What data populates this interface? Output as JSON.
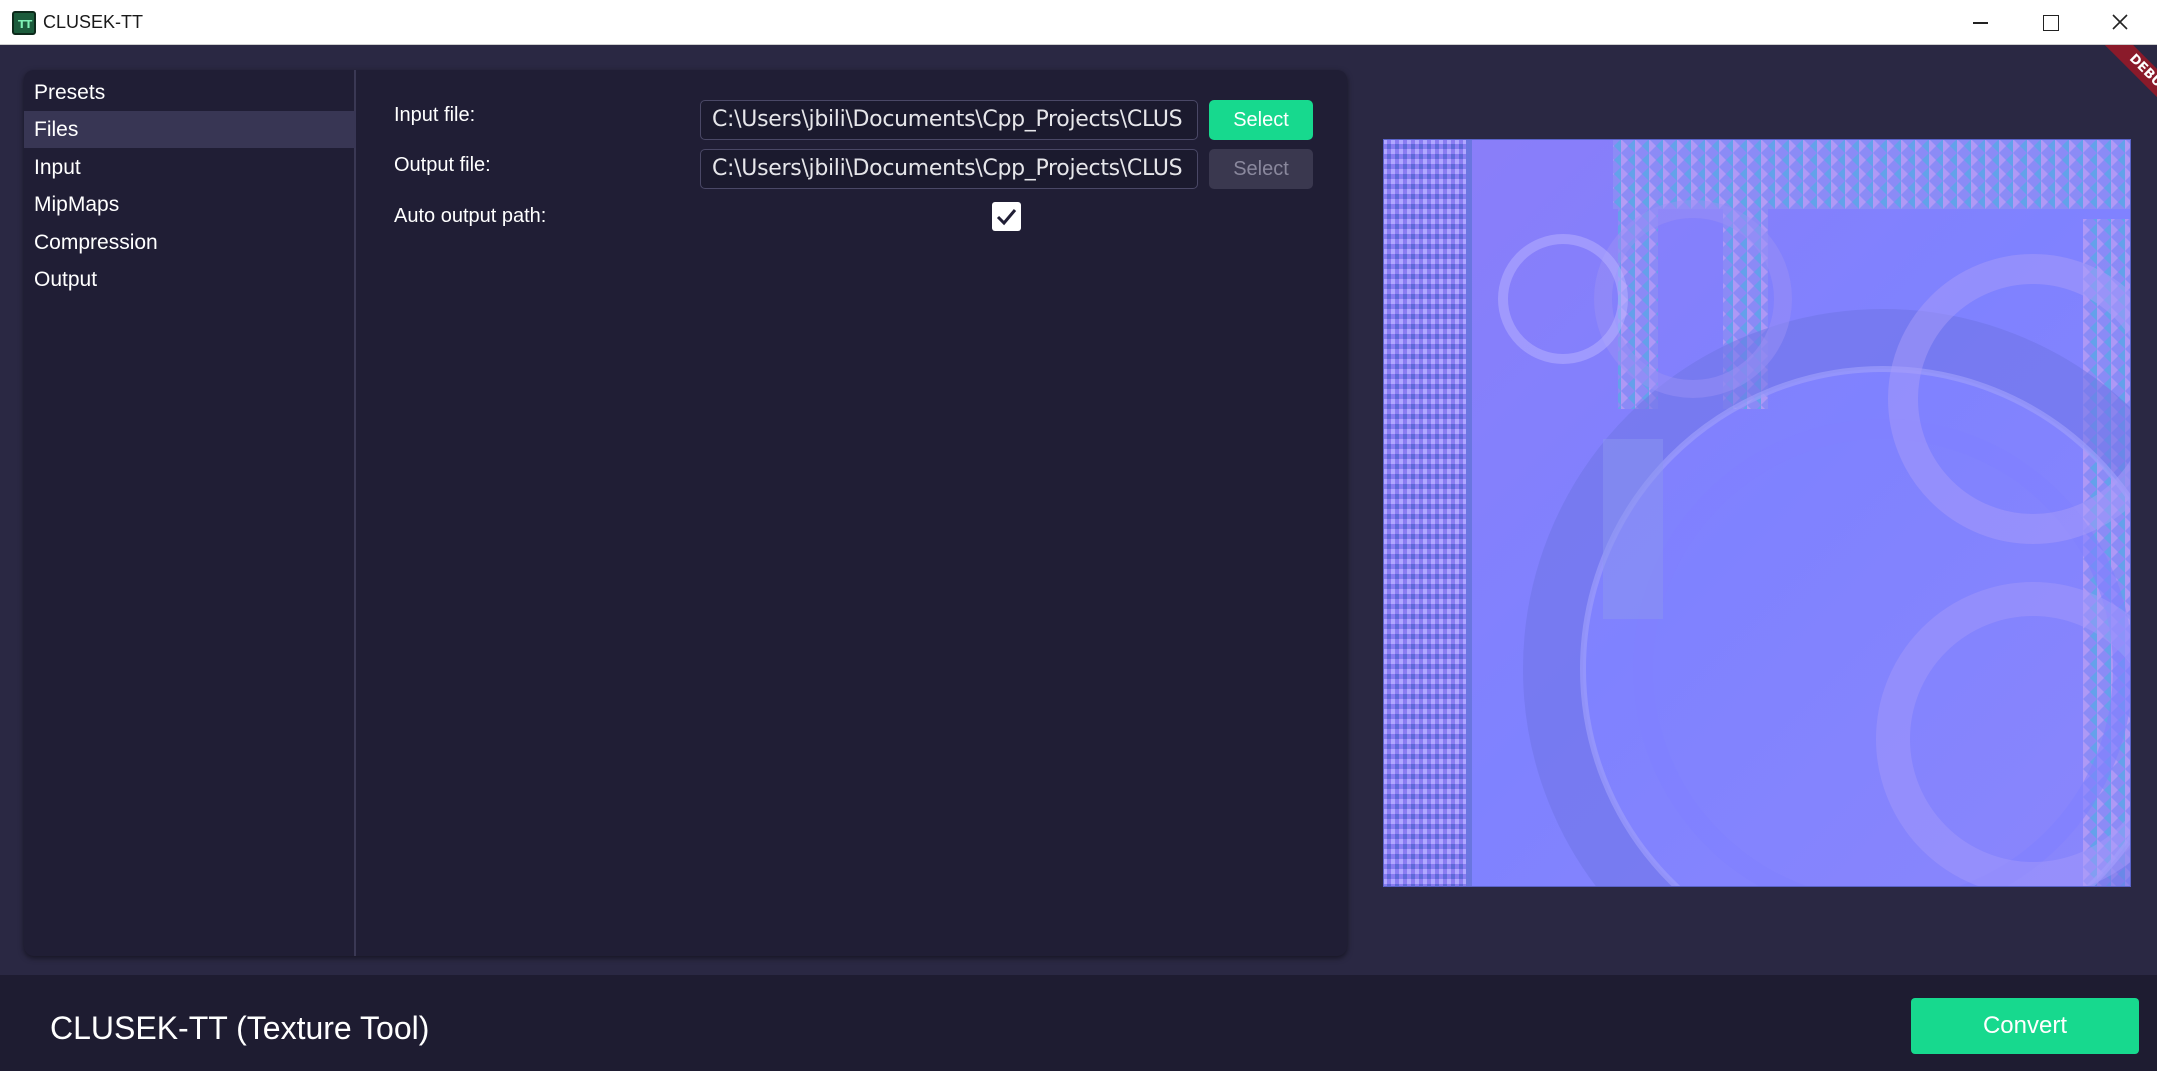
{
  "window": {
    "title": "CLUSEK-TT",
    "icon": "app-tt-icon",
    "controls": [
      "minimize-icon",
      "maximize-icon",
      "close-icon"
    ]
  },
  "debug_badge": "DEBUG",
  "sidebar": {
    "items": [
      {
        "label": "Presets"
      },
      {
        "label": "Files",
        "selected": true
      },
      {
        "label": "Input"
      },
      {
        "label": "MipMaps"
      },
      {
        "label": "Compression"
      },
      {
        "label": "Output"
      }
    ]
  },
  "files": {
    "input_label": "Input file:",
    "input_value": "C:\\Users\\jbili\\Documents\\Cpp_Projects\\CLUS",
    "input_select_label": "Select",
    "output_label": "Output file:",
    "output_value": "C:\\Users\\jbili\\Documents\\Cpp_Projects\\CLUS",
    "output_select_label": "Select",
    "auto_output_label": "Auto output path:",
    "auto_output_checked": true
  },
  "preview": {
    "description_icon": "normal-map-texture-preview"
  },
  "footer": {
    "caption": "CLUSEK-TT (Texture Tool)",
    "convert_label": "Convert"
  },
  "colors": {
    "accent": "#17d98e",
    "background": "#2a2843",
    "panel": "#201e35",
    "sidebar_selected": "#383654",
    "footer": "#1e1c31",
    "debug_ribbon": "#8a1a2a"
  }
}
